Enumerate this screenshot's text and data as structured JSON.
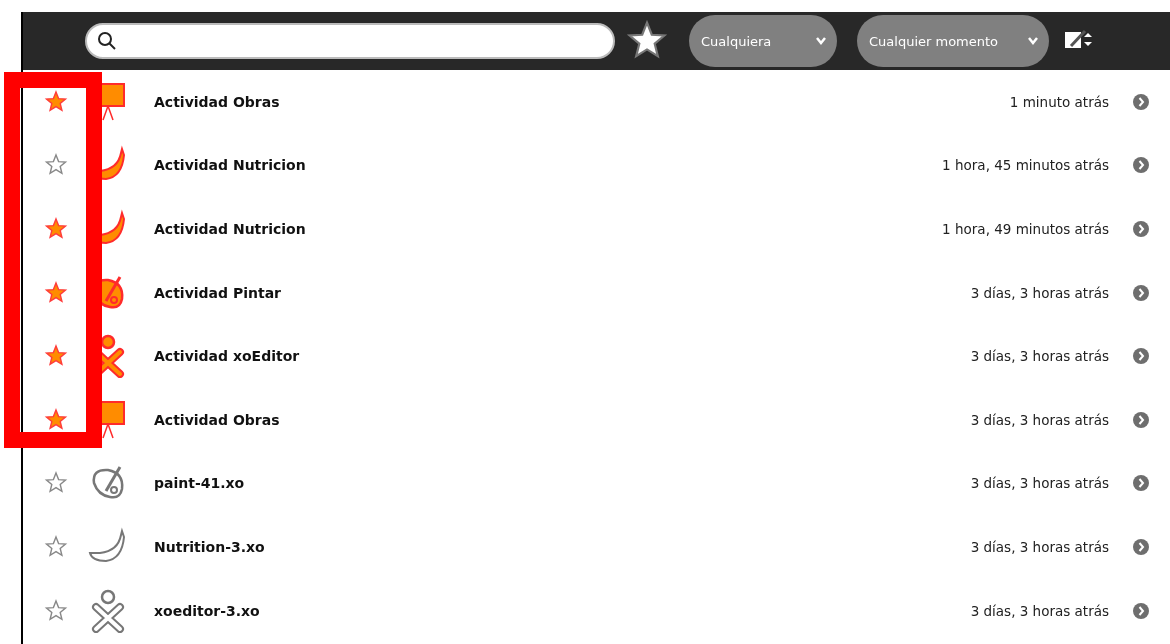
{
  "toolbar": {
    "filters": [
      {
        "label": "Cualquiera"
      },
      {
        "label": "Cualquier momento"
      }
    ]
  },
  "entries": [
    {
      "title": "Actividad Obras",
      "time": "1 minuto atrás",
      "starred": true,
      "kind": "easel",
      "colored": true
    },
    {
      "title": "Actividad Nutricion",
      "time": "1 hora, 45 minutos atrás",
      "starred": false,
      "kind": "banana",
      "colored": true
    },
    {
      "title": "Actividad Nutricion",
      "time": "1 hora, 49 minutos atrás",
      "starred": true,
      "kind": "banana",
      "colored": true
    },
    {
      "title": "Actividad Pintar",
      "time": "3 días, 3 horas atrás",
      "starred": true,
      "kind": "palette",
      "colored": true
    },
    {
      "title": "Actividad xoEditor",
      "time": "3 días, 3 horas atrás",
      "starred": true,
      "kind": "xo",
      "colored": true
    },
    {
      "title": "Actividad Obras",
      "time": "3 días, 3 horas atrás",
      "starred": true,
      "kind": "easel",
      "colored": true
    },
    {
      "title": "paint-41.xo",
      "time": "3 días, 3 horas atrás",
      "starred": false,
      "kind": "palette",
      "colored": false
    },
    {
      "title": "Nutrition-3.xo",
      "time": "3 días, 3 horas atrás",
      "starred": false,
      "kind": "banana",
      "colored": false
    },
    {
      "title": "xoeditor-3.xo",
      "time": "3 días, 3 horas atrás",
      "starred": false,
      "kind": "xo",
      "colored": false
    }
  ]
}
